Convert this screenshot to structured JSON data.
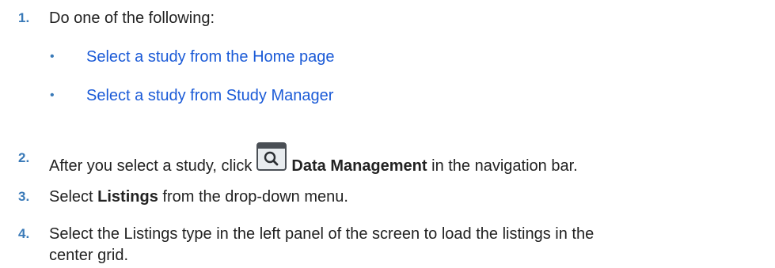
{
  "steps": [
    {
      "num": "1.",
      "text": "Do one of the following:",
      "subitems": [
        {
          "bullet": "•",
          "link": "Select a study from the Home page"
        },
        {
          "bullet": "•",
          "link": "Select a study from Study Manager"
        }
      ]
    },
    {
      "num": "2.",
      "before": "After you select a study, click",
      "bold": "Data Management",
      "after": " in the navigation bar."
    },
    {
      "num": "3.",
      "before": "Select ",
      "bold": "Listings",
      "after": " from the drop-down menu."
    },
    {
      "num": "4.",
      "line1": "Select the Listings type in the left panel of the screen to load the listings in the",
      "line2": "center grid."
    }
  ],
  "icons": {
    "data_management": "search-window-icon"
  }
}
